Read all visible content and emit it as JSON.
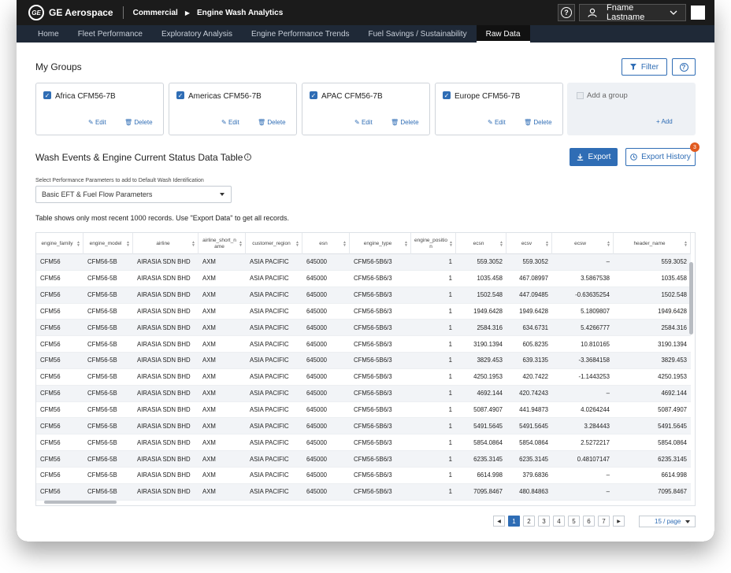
{
  "header": {
    "brand": "GE Aerospace",
    "breadcrumb": [
      "Commercial",
      "Engine Wash Analytics"
    ],
    "user_name": "Fname Lastname",
    "help_icon": "question-circle-icon"
  },
  "nav": {
    "tabs": [
      {
        "label": "Home",
        "active": false
      },
      {
        "label": "Fleet Performance",
        "active": false
      },
      {
        "label": "Exploratory Analysis",
        "active": false
      },
      {
        "label": "Engine Performance Trends",
        "active": false
      },
      {
        "label": "Fuel Savings / Sustainability",
        "active": false
      },
      {
        "label": "Raw Data",
        "active": true
      }
    ]
  },
  "groups": {
    "title": "My Groups",
    "filter_label": "Filter",
    "cards": [
      {
        "name": "Africa CFM56-7B",
        "edit": "Edit",
        "delete": "Delete"
      },
      {
        "name": "Americas CFM56-7B",
        "edit": "Edit",
        "delete": "Delete"
      },
      {
        "name": "APAC CFM56-7B",
        "edit": "Edit",
        "delete": "Delete"
      },
      {
        "name": "Europe CFM56-7B",
        "edit": "Edit",
        "delete": "Delete"
      }
    ],
    "add_group_label": "Add a group",
    "add_label": "+ Add"
  },
  "wash": {
    "title": "Wash Events & Engine Current Status Data Table",
    "export_label": "Export",
    "export_history_label": "Export History",
    "export_history_badge": "3",
    "param_label": "Select Performance Parameters to add to Default Wash Identification",
    "param_value": "Basic EFT & Fuel Flow Parameters",
    "note": "Table shows only most recent 1000 records. Use \"Export Data\" to get all records."
  },
  "table": {
    "columns": [
      "engine_family",
      "engine_model",
      "airline",
      "airline_short_n ame",
      "customer_region",
      "esn",
      "engine_type",
      "engine_positio n",
      "ecsn",
      "ecsv",
      "ecsw",
      "header_name"
    ],
    "rows": [
      [
        "CFM56",
        "CFM56-5B",
        "AIRASIA SDN BHD",
        "AXM",
        "ASIA PACIFIC",
        "645000",
        "CFM56-5B6/3",
        "1",
        "559.3052",
        "559.3052",
        "–",
        "559.3052"
      ],
      [
        "CFM56",
        "CFM56-5B",
        "AIRASIA SDN BHD",
        "AXM",
        "ASIA PACIFIC",
        "645000",
        "CFM56-5B6/3",
        "1",
        "1035.458",
        "467.08997",
        "3.5867538",
        "1035.458"
      ],
      [
        "CFM56",
        "CFM56-5B",
        "AIRASIA SDN BHD",
        "AXM",
        "ASIA PACIFIC",
        "645000",
        "CFM56-5B6/3",
        "1",
        "1502.548",
        "447.09485",
        "-0.63635254",
        "1502.548"
      ],
      [
        "CFM56",
        "CFM56-5B",
        "AIRASIA SDN BHD",
        "AXM",
        "ASIA PACIFIC",
        "645000",
        "CFM56-5B6/3",
        "1",
        "1949.6428",
        "1949.6428",
        "5.1809807",
        "1949.6428"
      ],
      [
        "CFM56",
        "CFM56-5B",
        "AIRASIA SDN BHD",
        "AXM",
        "ASIA PACIFIC",
        "645000",
        "CFM56-5B6/3",
        "1",
        "2584.316",
        "634.6731",
        "5.4266777",
        "2584.316"
      ],
      [
        "CFM56",
        "CFM56-5B",
        "AIRASIA SDN BHD",
        "AXM",
        "ASIA PACIFIC",
        "645000",
        "CFM56-5B6/3",
        "1",
        "3190.1394",
        "605.8235",
        "10.810165",
        "3190.1394"
      ],
      [
        "CFM56",
        "CFM56-5B",
        "AIRASIA SDN BHD",
        "AXM",
        "ASIA PACIFIC",
        "645000",
        "CFM56-5B6/3",
        "1",
        "3829.453",
        "639.3135",
        "-3.3684158",
        "3829.453"
      ],
      [
        "CFM56",
        "CFM56-5B",
        "AIRASIA SDN BHD",
        "AXM",
        "ASIA PACIFIC",
        "645000",
        "CFM56-5B6/3",
        "1",
        "4250.1953",
        "420.7422",
        "-1.1443253",
        "4250.1953"
      ],
      [
        "CFM56",
        "CFM56-5B",
        "AIRASIA SDN BHD",
        "AXM",
        "ASIA PACIFIC",
        "645000",
        "CFM56-5B6/3",
        "1",
        "4692.144",
        "420.74243",
        "–",
        "4692.144"
      ],
      [
        "CFM56",
        "CFM56-5B",
        "AIRASIA SDN BHD",
        "AXM",
        "ASIA PACIFIC",
        "645000",
        "CFM56-5B6/3",
        "1",
        "5087.4907",
        "441.94873",
        "4.0264244",
        "5087.4907"
      ],
      [
        "CFM56",
        "CFM56-5B",
        "AIRASIA SDN BHD",
        "AXM",
        "ASIA PACIFIC",
        "645000",
        "CFM56-5B6/3",
        "1",
        "5491.5645",
        "5491.5645",
        "3.284443",
        "5491.5645"
      ],
      [
        "CFM56",
        "CFM56-5B",
        "AIRASIA SDN BHD",
        "AXM",
        "ASIA PACIFIC",
        "645000",
        "CFM56-5B6/3",
        "1",
        "5854.0864",
        "5854.0864",
        "2.5272217",
        "5854.0864"
      ],
      [
        "CFM56",
        "CFM56-5B",
        "AIRASIA SDN BHD",
        "AXM",
        "ASIA PACIFIC",
        "645000",
        "CFM56-5B6/3",
        "1",
        "6235.3145",
        "6235.3145",
        "0.48107147",
        "6235.3145"
      ],
      [
        "CFM56",
        "CFM56-5B",
        "AIRASIA SDN BHD",
        "AXM",
        "ASIA PACIFIC",
        "645000",
        "CFM56-5B6/3",
        "1",
        "6614.998",
        "379.6836",
        "–",
        "6614.998"
      ],
      [
        "CFM56",
        "CFM56-5B",
        "AIRASIA SDN BHD",
        "AXM",
        "ASIA PACIFIC",
        "645000",
        "CFM56-5B6/3",
        "1",
        "7095.8467",
        "480.84863",
        "–",
        "7095.8467"
      ]
    ]
  },
  "pagination": {
    "pages": [
      "1",
      "2",
      "3",
      "4",
      "5",
      "6",
      "7"
    ],
    "current": "1",
    "per_page": "15 / page"
  },
  "colors": {
    "accent": "#2f6db5",
    "badge": "#e15a1f",
    "topbar": "#1b1b1b",
    "navbar": "#1f2937"
  }
}
